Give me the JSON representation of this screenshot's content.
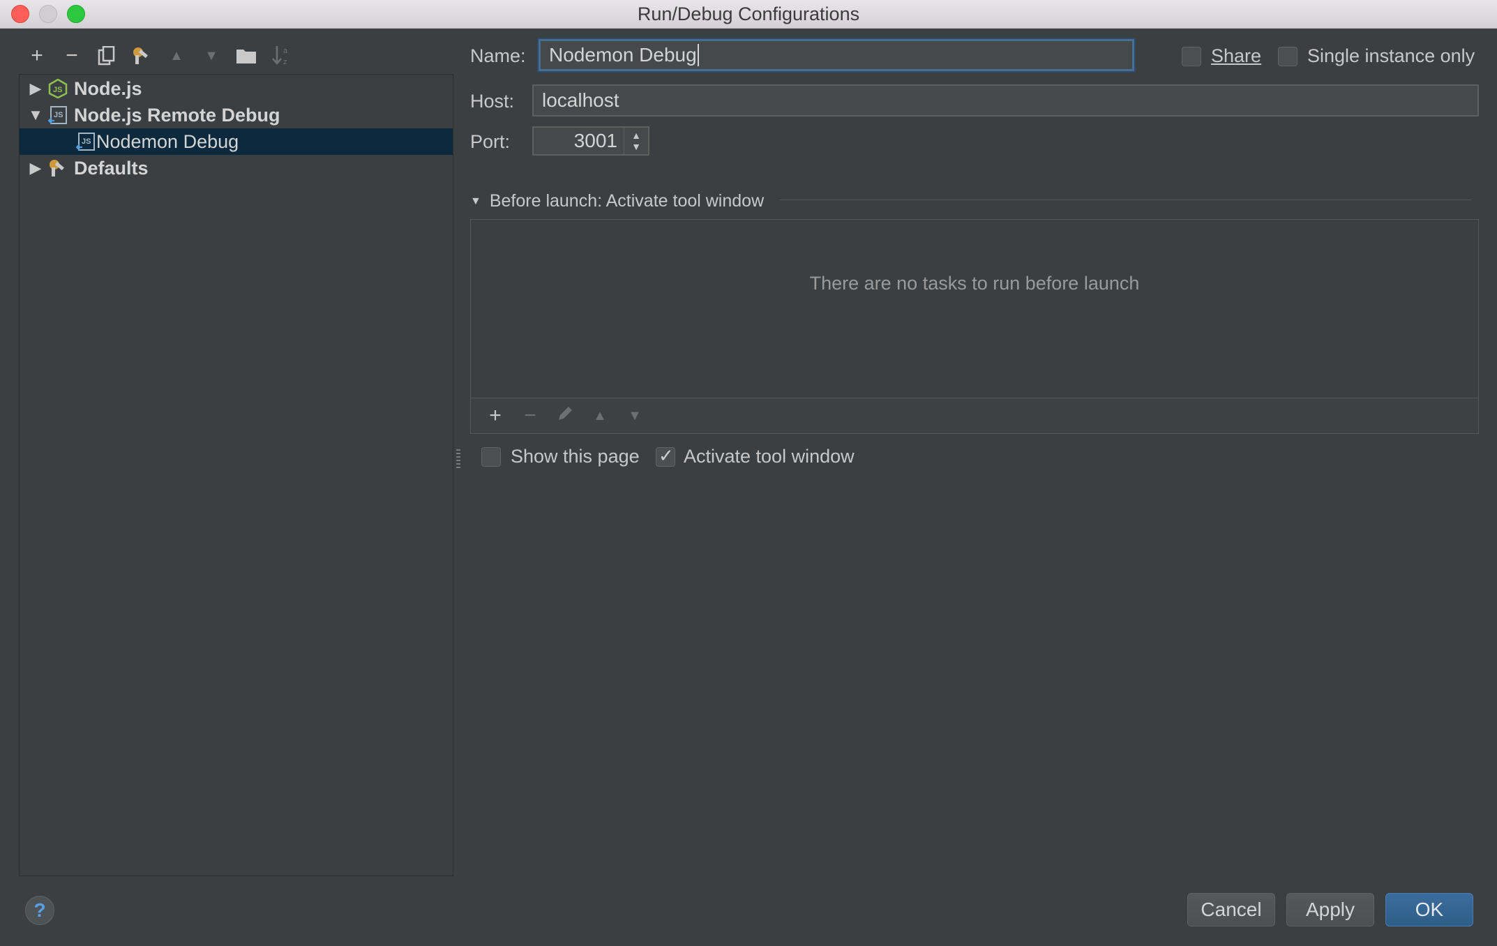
{
  "window": {
    "title": "Run/Debug Configurations"
  },
  "toolbar": {
    "items": [
      {
        "icon": "add-icon",
        "glyph": "+"
      },
      {
        "icon": "remove-icon",
        "glyph": "−"
      },
      {
        "icon": "copy-icon",
        "glyph": "⧉"
      },
      {
        "icon": "edit-defaults-icon",
        "glyph": "🔧"
      },
      {
        "icon": "move-up-icon",
        "glyph": "▲"
      },
      {
        "icon": "move-down-icon",
        "glyph": "▼"
      },
      {
        "icon": "folder-icon",
        "glyph": "▬"
      },
      {
        "icon": "sort-icon",
        "glyph": "↓"
      }
    ]
  },
  "tree": {
    "nodejs": "Node.js",
    "remote": "Node.js Remote Debug",
    "nodemon": "Nodemon Debug",
    "defaults": "Defaults"
  },
  "form": {
    "name_label": "Name:",
    "name_value": "Nodemon Debug",
    "host_label": "Host:",
    "host_value": "localhost",
    "port_label": "Port:",
    "port_value": "3001",
    "share_label": "Share",
    "share_checked": false,
    "single_label": "Single instance only",
    "single_checked": false
  },
  "before_launch": {
    "header": "Before launch: Activate tool window",
    "empty_text": "There are no tasks to run before launch",
    "show_page_label": "Show this page",
    "show_page_checked": false,
    "activate_label": "Activate tool window",
    "activate_checked": true
  },
  "buttons": {
    "help": "?",
    "cancel": "Cancel",
    "apply": "Apply",
    "ok": "OK"
  }
}
